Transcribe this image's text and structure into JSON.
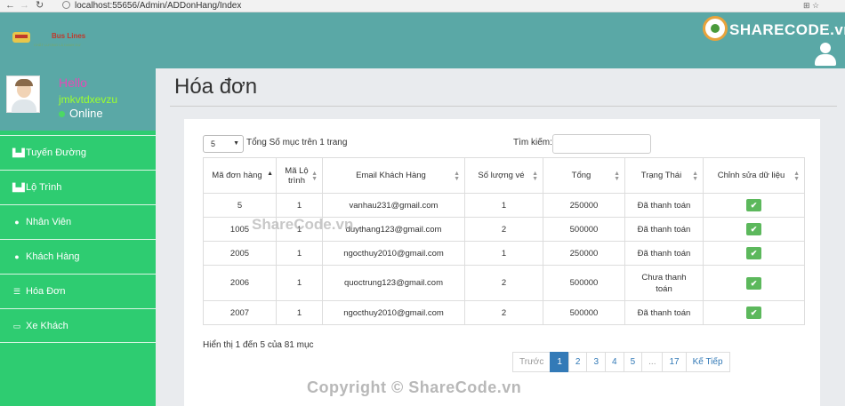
{
  "browser": {
    "url": "localhost:55656/Admin/ADDonHang/Index"
  },
  "header": {
    "logo_text": "Bus Lines",
    "logo_tagline": "CHẤT LƯỢNG LÀ DANH DỰ",
    "brand": "SHARECODE.vn"
  },
  "profile": {
    "greeting": "Hello",
    "username": "jmkvtdxevzu",
    "status": "Online"
  },
  "sidebar": {
    "items": [
      {
        "label": "Tuyến Đường",
        "icon": "road-icon"
      },
      {
        "label": "Lộ Trình",
        "icon": "road-icon"
      },
      {
        "label": "Nhân Viên",
        "icon": "user-icon"
      },
      {
        "label": "Khách Hàng",
        "icon": "user-icon"
      },
      {
        "label": "Hóa Đơn",
        "icon": "list-icon"
      },
      {
        "label": "Xe Khách",
        "icon": "credit-card-icon"
      }
    ]
  },
  "main": {
    "title": "Hóa đơn",
    "length_value": "5",
    "length_label": "Tổng Số mục trên 1 trang",
    "search_label": "Tìm kiếm:",
    "columns": [
      "Mã đơn hàng",
      "Mã Lộ trình",
      "Email Khách Hàng",
      "Số lượng vé",
      "Tổng",
      "Trạng Thái",
      "Chỉnh sửa dữ liệu"
    ],
    "rows": [
      {
        "c0": "5",
        "c1": "1",
        "c2": "vanhau231@gmail.com",
        "c3": "1",
        "c4": "250000",
        "c5": "Đã thanh toán"
      },
      {
        "c0": "1005",
        "c1": "1",
        "c2": "duythang123@gmail.com",
        "c3": "2",
        "c4": "500000",
        "c5": "Đã thanh toán"
      },
      {
        "c0": "2005",
        "c1": "1",
        "c2": "ngocthuy2010@gmail.com",
        "c3": "1",
        "c4": "250000",
        "c5": "Đã thanh toán"
      },
      {
        "c0": "2006",
        "c1": "1",
        "c2": "quoctrung123@gmail.com",
        "c3": "2",
        "c4": "500000",
        "c5": "Chưa thanh toán"
      },
      {
        "c0": "2007",
        "c1": "1",
        "c2": "ngocthuy2010@gmail.com",
        "c3": "2",
        "c4": "500000",
        "c5": "Đã thanh toán"
      }
    ],
    "info": "Hiển thị 1 đến 5 của 81 mục",
    "pager": {
      "prev": "Trước",
      "pages": [
        "1",
        "2",
        "3",
        "4",
        "5",
        "...",
        "17"
      ],
      "next": "Kế Tiếp"
    }
  },
  "watermark": "Copyright © ShareCode.vn",
  "watermark_mid": "ShareCode.vn"
}
